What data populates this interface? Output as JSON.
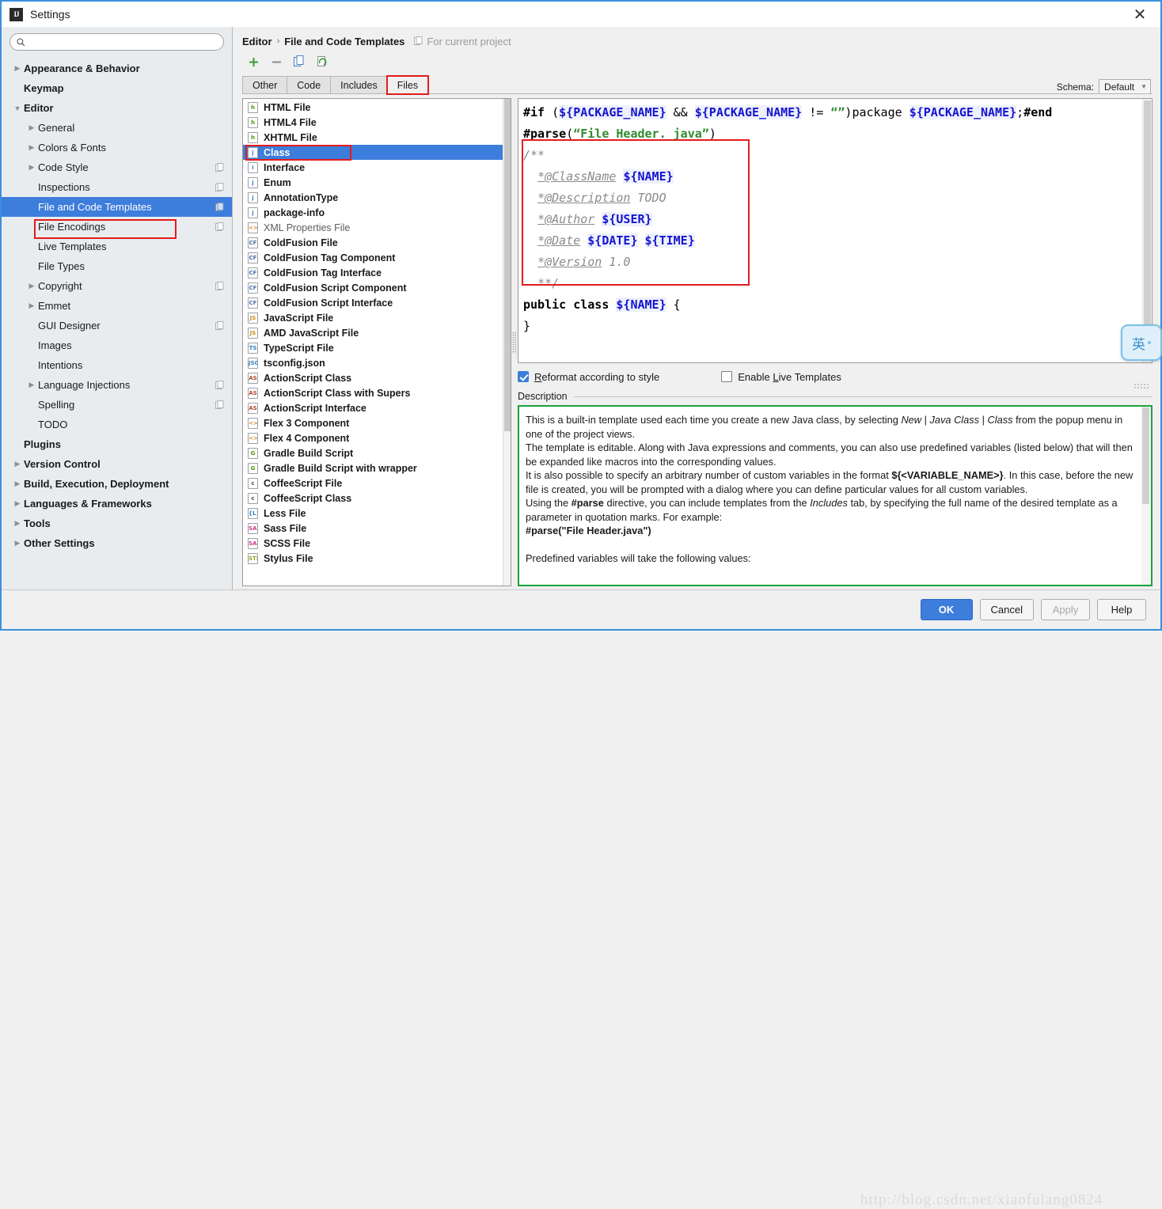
{
  "window": {
    "title": "Settings",
    "logo_icon": "intellij-idea-logo",
    "close_icon": "close-icon"
  },
  "sidebar": {
    "search": {
      "placeholder": "",
      "value": "",
      "icon": "search-icon"
    },
    "items": [
      {
        "label": "Appearance & Behavior",
        "level": 0,
        "bold": true,
        "arrow": "collapsed",
        "copy": false,
        "selected": false
      },
      {
        "label": "Keymap",
        "level": 0,
        "bold": true,
        "arrow": "none",
        "copy": false,
        "selected": false
      },
      {
        "label": "Editor",
        "level": 0,
        "bold": true,
        "arrow": "expanded",
        "copy": false,
        "selected": false
      },
      {
        "label": "General",
        "level": 1,
        "bold": false,
        "arrow": "collapsed",
        "copy": false,
        "selected": false
      },
      {
        "label": "Colors & Fonts",
        "level": 1,
        "bold": false,
        "arrow": "collapsed",
        "copy": false,
        "selected": false
      },
      {
        "label": "Code Style",
        "level": 1,
        "bold": false,
        "arrow": "collapsed",
        "copy": true,
        "selected": false
      },
      {
        "label": "Inspections",
        "level": 1,
        "bold": false,
        "arrow": "none",
        "copy": true,
        "selected": false
      },
      {
        "label": "File and Code Templates",
        "level": 1,
        "bold": false,
        "arrow": "none",
        "copy": true,
        "selected": true
      },
      {
        "label": "File Encodings",
        "level": 1,
        "bold": false,
        "arrow": "none",
        "copy": true,
        "selected": false
      },
      {
        "label": "Live Templates",
        "level": 1,
        "bold": false,
        "arrow": "none",
        "copy": false,
        "selected": false
      },
      {
        "label": "File Types",
        "level": 1,
        "bold": false,
        "arrow": "none",
        "copy": false,
        "selected": false
      },
      {
        "label": "Copyright",
        "level": 1,
        "bold": false,
        "arrow": "collapsed",
        "copy": true,
        "selected": false
      },
      {
        "label": "Emmet",
        "level": 1,
        "bold": false,
        "arrow": "collapsed",
        "copy": false,
        "selected": false
      },
      {
        "label": "GUI Designer",
        "level": 1,
        "bold": false,
        "arrow": "none",
        "copy": true,
        "selected": false
      },
      {
        "label": "Images",
        "level": 1,
        "bold": false,
        "arrow": "none",
        "copy": false,
        "selected": false
      },
      {
        "label": "Intentions",
        "level": 1,
        "bold": false,
        "arrow": "none",
        "copy": false,
        "selected": false
      },
      {
        "label": "Language Injections",
        "level": 1,
        "bold": false,
        "arrow": "collapsed",
        "copy": true,
        "selected": false
      },
      {
        "label": "Spelling",
        "level": 1,
        "bold": false,
        "arrow": "none",
        "copy": true,
        "selected": false
      },
      {
        "label": "TODO",
        "level": 1,
        "bold": false,
        "arrow": "none",
        "copy": false,
        "selected": false
      },
      {
        "label": "Plugins",
        "level": 0,
        "bold": true,
        "arrow": "none",
        "copy": false,
        "selected": false
      },
      {
        "label": "Version Control",
        "level": 0,
        "bold": true,
        "arrow": "collapsed",
        "copy": false,
        "selected": false
      },
      {
        "label": "Build, Execution, Deployment",
        "level": 0,
        "bold": true,
        "arrow": "collapsed",
        "copy": false,
        "selected": false
      },
      {
        "label": "Languages & Frameworks",
        "level": 0,
        "bold": true,
        "arrow": "collapsed",
        "copy": false,
        "selected": false
      },
      {
        "label": "Tools",
        "level": 0,
        "bold": true,
        "arrow": "collapsed",
        "copy": false,
        "selected": false
      },
      {
        "label": "Other Settings",
        "level": 0,
        "bold": true,
        "arrow": "collapsed",
        "copy": false,
        "selected": false
      }
    ]
  },
  "breadcrumb": {
    "parent": "Editor",
    "separator": "›",
    "current": "File and Code Templates",
    "scope_note": "For current project",
    "scope_icon": "project-scope-icon"
  },
  "toolbar": {
    "add_icon": "plus-icon",
    "remove_icon": "minus-icon",
    "copy_icon": "copy-icon",
    "reset_icon": "reset-icon"
  },
  "schema": {
    "label": "Schema:",
    "value": "Default",
    "caret_icon": "chevron-down-icon"
  },
  "tabs": [
    {
      "label": "Files",
      "active": true,
      "highlighted": true
    },
    {
      "label": "Includes",
      "active": false,
      "highlighted": false
    },
    {
      "label": "Code",
      "active": false,
      "highlighted": false
    },
    {
      "label": "Other",
      "active": false,
      "highlighted": false
    }
  ],
  "file_list": {
    "selected": "Class",
    "items": [
      {
        "label": "HTML File",
        "icon": "html-file-icon",
        "icon_text": "h",
        "icon_color": "#4e9a06",
        "dim": false
      },
      {
        "label": "HTML4 File",
        "icon": "html-file-icon",
        "icon_text": "h",
        "icon_color": "#4e9a06",
        "dim": false
      },
      {
        "label": "XHTML File",
        "icon": "xhtml-file-icon",
        "icon_text": "h",
        "icon_color": "#4e9a06",
        "dim": false
      },
      {
        "label": "Class",
        "icon": "java-class-icon",
        "icon_text": "j",
        "icon_color": "#3b7fd4",
        "dim": false
      },
      {
        "label": "Interface",
        "icon": "java-interface-icon",
        "icon_text": "i",
        "icon_color": "#3b7fd4",
        "dim": false
      },
      {
        "label": "Enum",
        "icon": "java-enum-icon",
        "icon_text": "j",
        "icon_color": "#3b7fd4",
        "dim": false
      },
      {
        "label": "AnnotationType",
        "icon": "java-annotation-icon",
        "icon_text": "j",
        "icon_color": "#3b7fd4",
        "dim": false
      },
      {
        "label": "package-info",
        "icon": "java-package-icon",
        "icon_text": "j",
        "icon_color": "#3b7fd4",
        "dim": false
      },
      {
        "label": "XML Properties File",
        "icon": "xml-file-icon",
        "icon_text": "<>",
        "icon_color": "#d98a28",
        "dim": true
      },
      {
        "label": "ColdFusion File",
        "icon": "coldfusion-icon",
        "icon_text": "CF",
        "icon_color": "#4a6ea8",
        "dim": false
      },
      {
        "label": "ColdFusion Tag Component",
        "icon": "coldfusion-icon",
        "icon_text": "CF",
        "icon_color": "#4a6ea8",
        "dim": false
      },
      {
        "label": "ColdFusion Tag Interface",
        "icon": "coldfusion-icon",
        "icon_text": "CF",
        "icon_color": "#4a6ea8",
        "dim": false
      },
      {
        "label": "ColdFusion Script Component",
        "icon": "coldfusion-icon",
        "icon_text": "CF",
        "icon_color": "#4a6ea8",
        "dim": false
      },
      {
        "label": "ColdFusion Script Interface",
        "icon": "coldfusion-icon",
        "icon_text": "CF",
        "icon_color": "#4a6ea8",
        "dim": false
      },
      {
        "label": "JavaScript File",
        "icon": "javascript-file-icon",
        "icon_text": "JS",
        "icon_color": "#c98b1e",
        "dim": false
      },
      {
        "label": "AMD JavaScript File",
        "icon": "javascript-file-icon",
        "icon_text": "JS",
        "icon_color": "#c98b1e",
        "dim": false
      },
      {
        "label": "TypeScript File",
        "icon": "typescript-file-icon",
        "icon_text": "TS",
        "icon_color": "#2f7fc1",
        "dim": false
      },
      {
        "label": "tsconfig.json",
        "icon": "json-file-icon",
        "icon_text": "JSON",
        "icon_color": "#2f7fc1",
        "dim": false
      },
      {
        "label": "ActionScript Class",
        "icon": "actionscript-icon",
        "icon_text": "AS",
        "icon_color": "#b04a2e",
        "dim": false
      },
      {
        "label": "ActionScript Class with Supers",
        "icon": "actionscript-icon",
        "icon_text": "AS",
        "icon_color": "#b04a2e",
        "dim": false
      },
      {
        "label": "ActionScript Interface",
        "icon": "actionscript-icon",
        "icon_text": "AS",
        "icon_color": "#b04a2e",
        "dim": false
      },
      {
        "label": "Flex 3 Component",
        "icon": "flex-component-icon",
        "icon_text": "<>",
        "icon_color": "#d98a28",
        "dim": false
      },
      {
        "label": "Flex 4 Component",
        "icon": "flex-component-icon",
        "icon_text": "<>",
        "icon_color": "#d98a28",
        "dim": false
      },
      {
        "label": "Gradle Build Script",
        "icon": "gradle-icon",
        "icon_text": "G",
        "icon_color": "#4e9a06",
        "dim": false
      },
      {
        "label": "Gradle Build Script with wrapper",
        "icon": "gradle-icon",
        "icon_text": "G",
        "icon_color": "#4e9a06",
        "dim": false
      },
      {
        "label": "CoffeeScript File",
        "icon": "coffeescript-icon",
        "icon_text": "c",
        "icon_color": "#555555",
        "dim": false
      },
      {
        "label": "CoffeeScript Class",
        "icon": "coffeescript-icon",
        "icon_text": "c",
        "icon_color": "#555555",
        "dim": false
      },
      {
        "label": "Less File",
        "icon": "less-file-icon",
        "icon_text": "{L}",
        "icon_color": "#2f7fc1",
        "dim": false
      },
      {
        "label": "Sass File",
        "icon": "sass-file-icon",
        "icon_text": "SASS",
        "icon_color": "#cf3a84",
        "dim": false
      },
      {
        "label": "SCSS File",
        "icon": "scss-file-icon",
        "icon_text": "SASS",
        "icon_color": "#cf3a84",
        "dim": false
      },
      {
        "label": "Stylus File",
        "icon": "stylus-file-icon",
        "icon_text": "STIL",
        "icon_color": "#8aa81e",
        "dim": false
      }
    ]
  },
  "editor": {
    "lines": [
      [
        {
          "t": "#if ",
          "c": "dir"
        },
        {
          "t": "(",
          "c": "plain"
        },
        {
          "t": "${PACKAGE_NAME}",
          "c": "var"
        },
        {
          "t": " && ",
          "c": "plain"
        },
        {
          "t": "${PACKAGE_NAME}",
          "c": "var"
        },
        {
          "t": " != ",
          "c": "plain"
        },
        {
          "t": "“”",
          "c": "str"
        },
        {
          "t": ")",
          "c": "plain"
        },
        {
          "t": "package ",
          "c": "plain"
        },
        {
          "t": "${PACKAGE_NAME}",
          "c": "var"
        },
        {
          "t": ";",
          "c": "plain"
        },
        {
          "t": "#end",
          "c": "dir"
        }
      ],
      [
        {
          "t": "#parse",
          "c": "dir"
        },
        {
          "t": "(",
          "c": "plain"
        },
        {
          "t": "“File Header. java”",
          "c": "str"
        },
        {
          "t": ")",
          "c": "plain"
        }
      ],
      [
        {
          "t": "/**",
          "c": "cmt"
        }
      ],
      [
        {
          "t": "  ",
          "c": "plain"
        },
        {
          "t": "*@ClassName",
          "c": "cmtu"
        },
        {
          "t": " ",
          "c": "plain"
        },
        {
          "t": "${NAME}",
          "c": "var"
        }
      ],
      [
        {
          "t": "  ",
          "c": "plain"
        },
        {
          "t": "*@Description",
          "c": "cmtu"
        },
        {
          "t": " TODO",
          "c": "cmt"
        }
      ],
      [
        {
          "t": "  ",
          "c": "plain"
        },
        {
          "t": "*@Author",
          "c": "cmtu"
        },
        {
          "t": " ",
          "c": "plain"
        },
        {
          "t": "${USER}",
          "c": "var"
        }
      ],
      [
        {
          "t": "  ",
          "c": "plain"
        },
        {
          "t": "*@Date",
          "c": "cmtu"
        },
        {
          "t": " ",
          "c": "plain"
        },
        {
          "t": "${DATE}",
          "c": "var"
        },
        {
          "t": " ",
          "c": "plain"
        },
        {
          "t": "${TIME}",
          "c": "var"
        }
      ],
      [
        {
          "t": "  ",
          "c": "plain"
        },
        {
          "t": "*@Version",
          "c": "cmtu"
        },
        {
          "t": " 1.0",
          "c": "cmt"
        }
      ],
      [
        {
          "t": "  ",
          "c": "plain"
        },
        {
          "t": "**/",
          "c": "cmt"
        }
      ],
      [
        {
          "t": "public class ",
          "c": "kw"
        },
        {
          "t": "${NAME}",
          "c": "var"
        },
        {
          "t": " {",
          "c": "plain"
        }
      ],
      [
        {
          "t": "}",
          "c": "plain"
        }
      ]
    ]
  },
  "options": {
    "reformat": {
      "label_pre": "",
      "label_u": "R",
      "label_post": "eformat according to style",
      "checked": true
    },
    "live_templates": {
      "label_pre": "Enable ",
      "label_u": "L",
      "label_post": "ive Templates",
      "checked": false
    }
  },
  "description": {
    "title": "Description",
    "paragraphs": [
      "This is a built-in template used each time you create a new Java class, by selecting <i>New</i> | <i>Java Class</i> | <i>Class</i> from the popup menu in one of the project views.",
      "The template is editable. Along with Java expressions and comments, you can also use predefined variables (listed below) that will then be expanded like macros into the corresponding values.",
      "It is also possible to specify an arbitrary number of custom variables in the format <b>${&lt;VARIABLE_NAME&gt;}</b>. In this case, before the new file is created, you will be prompted with a dialog where you can define particular values for all custom variables.",
      "Using the <b>#parse</b> directive, you can include templates from the <i>Includes</i> tab, by specifying the full name of the desired template as a parameter in quotation marks. For example:",
      "<b>#parse(\"File Header.java\")</b>",
      "",
      "Predefined variables will take the following values:"
    ]
  },
  "footer": {
    "buttons": [
      {
        "label": "OK",
        "style": "primary"
      },
      {
        "label": "Cancel",
        "style": "normal"
      },
      {
        "label": "Apply",
        "style": "disabled"
      },
      {
        "label": "Help",
        "style": "normal"
      }
    ],
    "watermark": "http://blog.csdn.net/xiaofulang0824"
  },
  "ime": {
    "mode_glyph": "英"
  },
  "colors": {
    "selection_blue": "#3d7ddb",
    "highlight_red": "#e31c1c",
    "highlight_green": "#1aa33a",
    "window_border": "#3c8fe0"
  }
}
